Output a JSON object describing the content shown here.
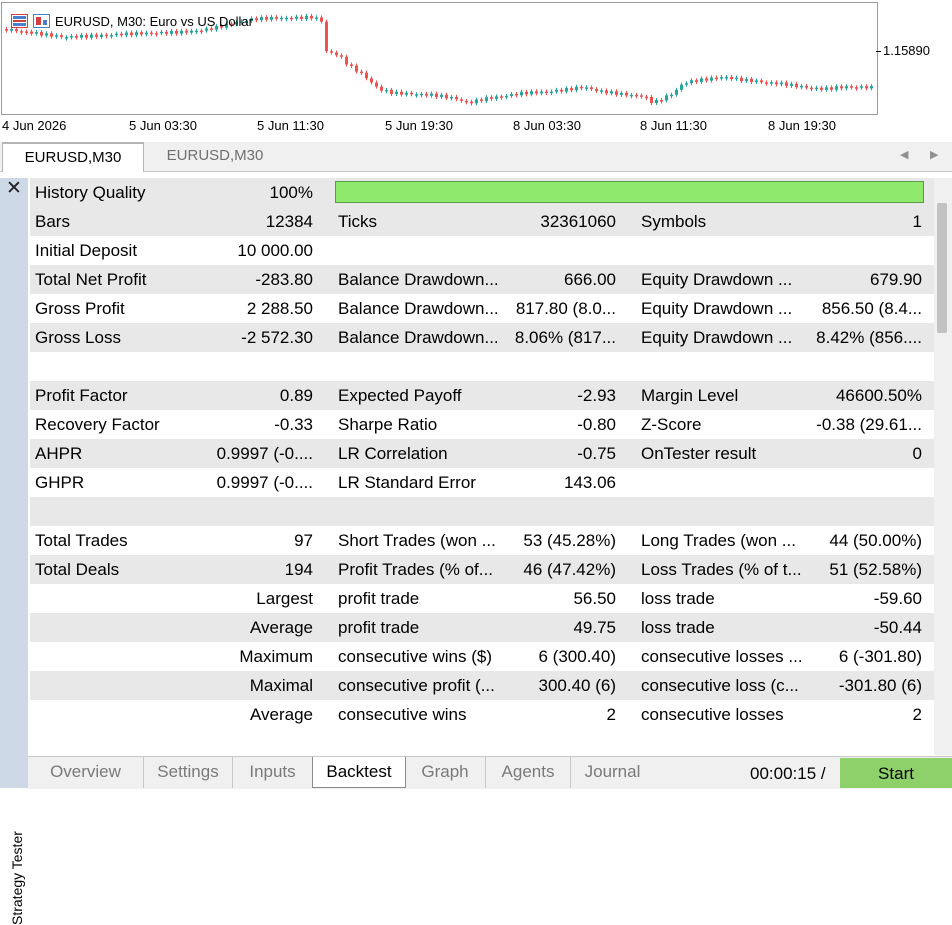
{
  "chart": {
    "title": "EURUSD, M30:  Euro vs US Dollar",
    "price_label": "1.15890",
    "time_labels": [
      "4 Jun 2026",
      "5 Jun 03:30",
      "5 Jun 11:30",
      "5 Jun 19:30",
      "8 Jun 03:30",
      "8 Jun 11:30",
      "8 Jun 19:30"
    ],
    "up_color": "#26a69a",
    "down_color": "#ef5350",
    "icons": [
      "chart-grid-icon",
      "chart-pane-icon"
    ]
  },
  "chart_tabs": [
    "EURUSD,M30",
    "EURUSD,M30"
  ],
  "strip": {
    "label": "Strategy Tester",
    "close_icon": "✕"
  },
  "results": {
    "history_quality": {
      "label": "History Quality",
      "value": "100%",
      "bar_fill": 1.0
    },
    "rows": [
      {
        "c1": [
          "Bars",
          "12384"
        ],
        "c2": [
          "Ticks",
          "32361060"
        ],
        "c3": [
          "Symbols",
          "1"
        ]
      },
      {
        "c1": [
          "Initial Deposit",
          "10 000.00"
        ],
        "c2": [
          "",
          ""
        ],
        "c3": [
          "",
          ""
        ]
      },
      {
        "c1": [
          "Total Net Profit",
          "-283.80"
        ],
        "c2": [
          "Balance Drawdown...",
          "666.00"
        ],
        "c3": [
          "Equity Drawdown ...",
          "679.90"
        ]
      },
      {
        "c1": [
          "Gross Profit",
          "2 288.50"
        ],
        "c2": [
          "Balance Drawdown...",
          "817.80 (8.0..."
        ],
        "c3": [
          "Equity Drawdown ...",
          "856.50 (8.4..."
        ]
      },
      {
        "c1": [
          "Gross Loss",
          "-2 572.30"
        ],
        "c2": [
          "Balance Drawdown...",
          "8.06% (817..."
        ],
        "c3": [
          "Equity Drawdown ...",
          "8.42% (856...."
        ]
      },
      {
        "c1": [
          "",
          ""
        ],
        "c2": [
          "",
          ""
        ],
        "c3": [
          "",
          ""
        ]
      },
      {
        "c1": [
          "Profit Factor",
          "0.89"
        ],
        "c2": [
          "Expected Payoff",
          "-2.93"
        ],
        "c3": [
          "Margin Level",
          "46600.50%"
        ]
      },
      {
        "c1": [
          "Recovery Factor",
          "-0.33"
        ],
        "c2": [
          "Sharpe Ratio",
          "-0.80"
        ],
        "c3": [
          "Z-Score",
          "-0.38 (29.61..."
        ]
      },
      {
        "c1": [
          "AHPR",
          "0.9997 (-0...."
        ],
        "c2": [
          "LR Correlation",
          "-0.75"
        ],
        "c3": [
          "OnTester result",
          "0"
        ]
      },
      {
        "c1": [
          "GHPR",
          "0.9997 (-0...."
        ],
        "c2": [
          "LR Standard Error",
          "143.06"
        ],
        "c3": [
          "",
          ""
        ]
      },
      {
        "c1": [
          "",
          ""
        ],
        "c2": [
          "",
          ""
        ],
        "c3": [
          "",
          ""
        ]
      },
      {
        "c1": [
          "Total Trades",
          "97"
        ],
        "c2": [
          "Short Trades (won ...",
          "53 (45.28%)"
        ],
        "c3": [
          "Long Trades (won ...",
          "44 (50.00%)"
        ]
      },
      {
        "c1": [
          "Total Deals",
          "194"
        ],
        "c2": [
          "Profit Trades (% of...",
          "46 (47.42%)"
        ],
        "c3": [
          "Loss Trades (% of t...",
          "51 (52.58%)"
        ]
      },
      {
        "c1": [
          "",
          "Largest"
        ],
        "c2": [
          "profit trade",
          "56.50"
        ],
        "c3": [
          "loss trade",
          "-59.60"
        ]
      },
      {
        "c1": [
          "",
          "Average"
        ],
        "c2": [
          "profit trade",
          "49.75"
        ],
        "c3": [
          "loss trade",
          "-50.44"
        ]
      },
      {
        "c1": [
          "",
          "Maximum"
        ],
        "c2": [
          "consecutive wins ($)",
          "6 (300.40)"
        ],
        "c3": [
          "consecutive losses ...",
          "6 (-301.80)"
        ]
      },
      {
        "c1": [
          "",
          "Maximal"
        ],
        "c2": [
          "consecutive profit (...",
          "300.40 (6)"
        ],
        "c3": [
          "consecutive loss (c...",
          "-301.80 (6)"
        ]
      },
      {
        "c1": [
          "",
          "Average"
        ],
        "c2": [
          "consecutive wins",
          "2"
        ],
        "c3": [
          "consecutive losses",
          "2"
        ]
      }
    ]
  },
  "bottom_tabs": [
    "Overview",
    "Settings",
    "Inputs",
    "Backtest",
    "Graph",
    "Agents",
    "Journal"
  ],
  "active_tab": "Backtest",
  "timer": "00:00:15 /",
  "start_label": "Start"
}
